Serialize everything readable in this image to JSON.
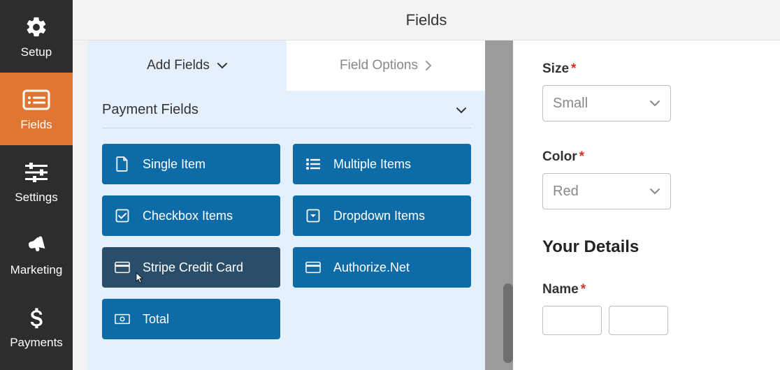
{
  "nav": {
    "items": [
      {
        "key": "setup",
        "label": "Setup"
      },
      {
        "key": "fields",
        "label": "Fields"
      },
      {
        "key": "settings",
        "label": "Settings"
      },
      {
        "key": "marketing",
        "label": "Marketing"
      },
      {
        "key": "payments",
        "label": "Payments"
      }
    ],
    "active": "fields"
  },
  "header": {
    "title": "Fields"
  },
  "tabs": {
    "add": "Add Fields",
    "options": "Field Options"
  },
  "section": {
    "title": "Payment Fields"
  },
  "fields": {
    "single_item": "Single Item",
    "multiple_items": "Multiple Items",
    "checkbox_items": "Checkbox Items",
    "dropdown_items": "Dropdown Items",
    "stripe": "Stripe Credit Card",
    "authorize": "Authorize.Net",
    "total": "Total"
  },
  "preview": {
    "size": {
      "label": "Size",
      "value": "Small"
    },
    "color": {
      "label": "Color",
      "value": "Red"
    },
    "section_title": "Your Details",
    "name": {
      "label": "Name"
    }
  }
}
